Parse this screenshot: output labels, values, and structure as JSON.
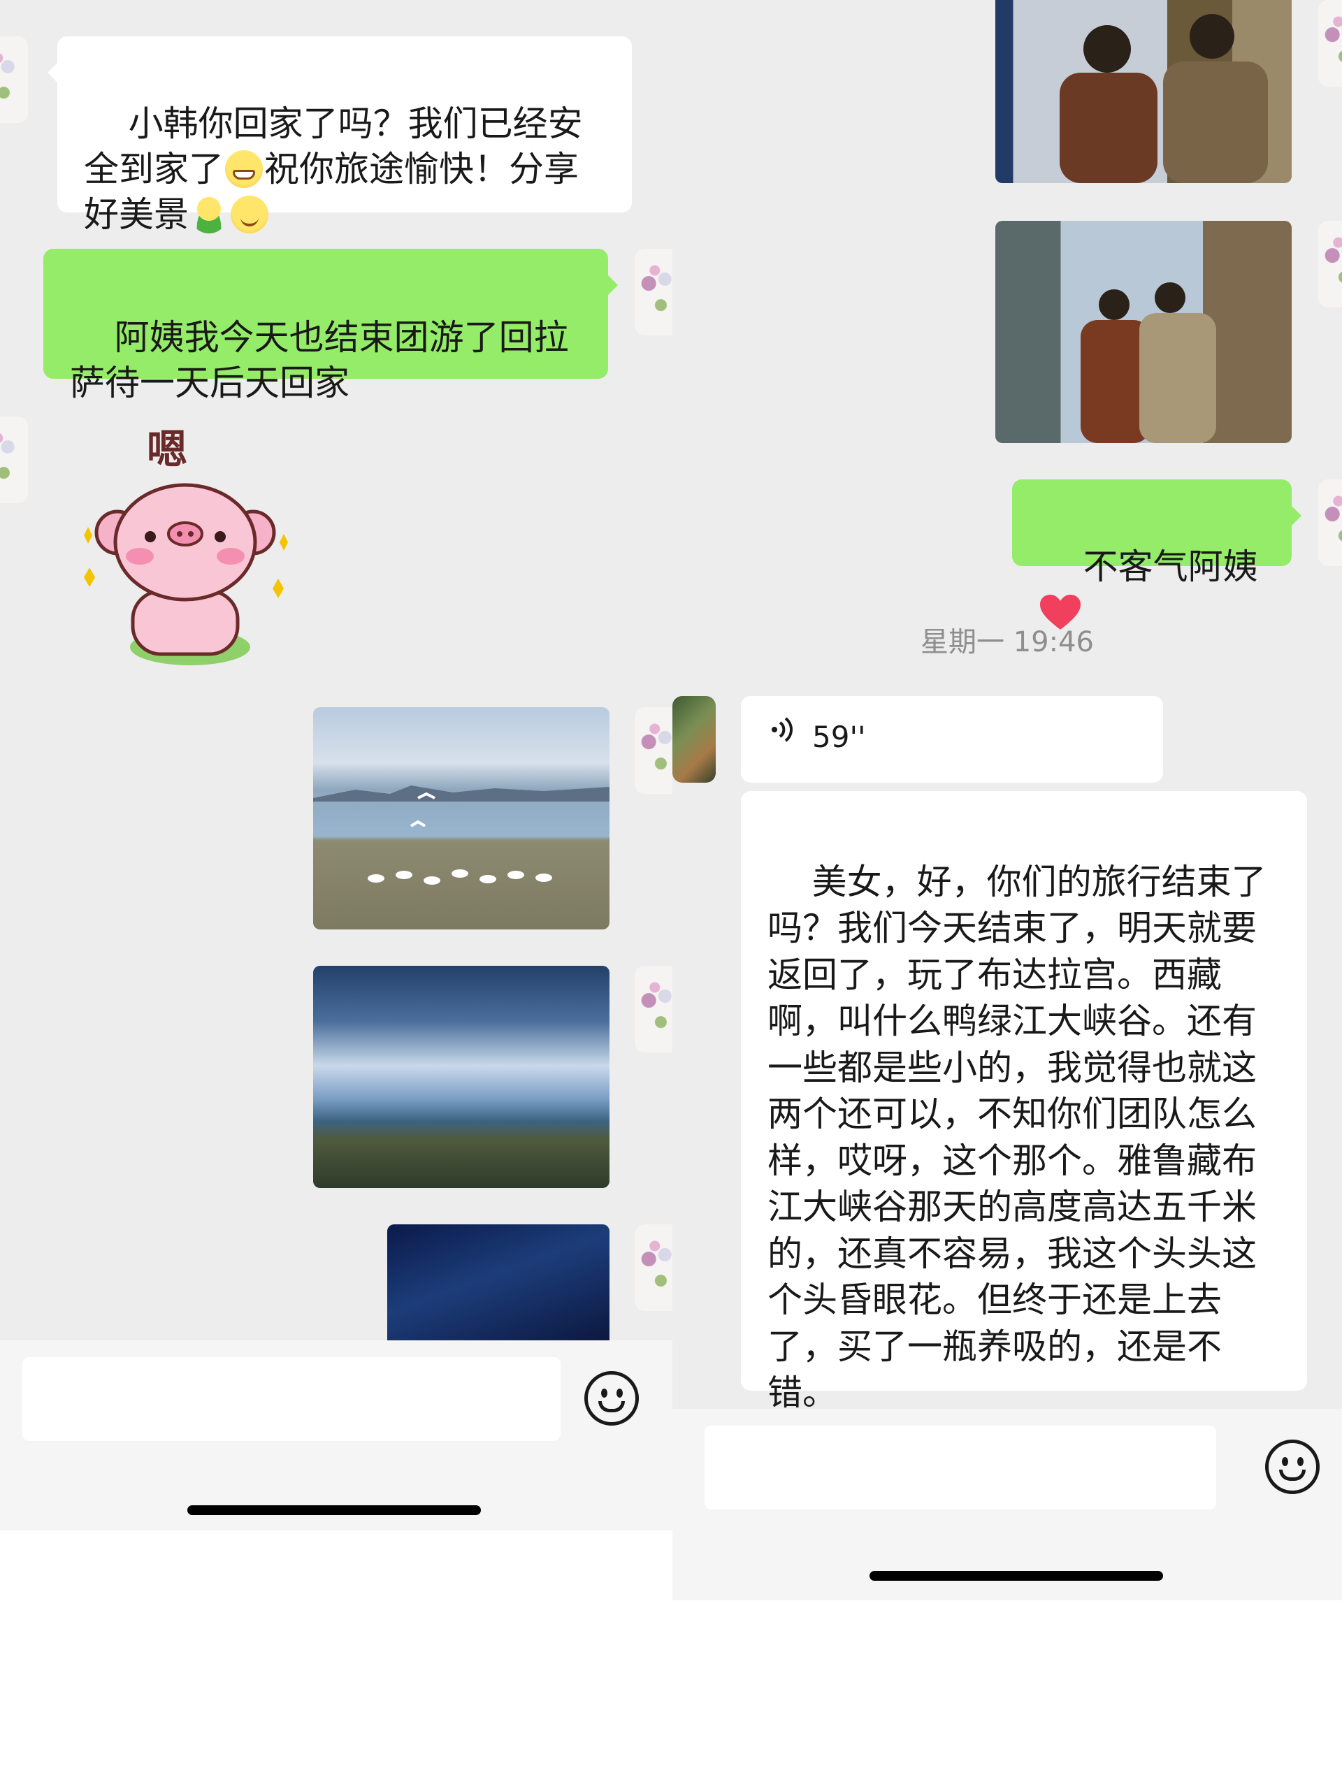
{
  "left_panel": {
    "messages": [
      {
        "from": "other",
        "text_part1": "小韩你回家了吗？我们已经安全到家了",
        "emoji1": "grin",
        "text_part2": "祝你旅途愉快！分享好美景",
        "emoji2": "hug",
        "emoji3": "smile"
      },
      {
        "from": "me",
        "text": "阿姨我今天也结束团游了回拉萨待一天后天回家"
      },
      {
        "from": "other",
        "sticker": "pig-sticker",
        "sticker_text": "嗯"
      },
      {
        "from": "me",
        "image": "lake-birds-photo"
      },
      {
        "from": "me",
        "image": "lake-sky-photo"
      },
      {
        "from": "me",
        "image": "night-sky-photo"
      }
    ]
  },
  "right_panel": {
    "messages": [
      {
        "from": "me",
        "image": "train-window-photo-1"
      },
      {
        "from": "me",
        "image": "train-window-photo-2"
      },
      {
        "from": "me",
        "text": "不客气阿姨",
        "emoji": "heart"
      }
    ],
    "timestamp": "星期一 19:46",
    "voice": {
      "duration": "59''"
    },
    "long_text": "美女，好，你们的旅行结束了吗？我们今天结束了，明天就要返回了，玩了布达拉宫。西藏啊，叫什么鸭绿江大峡谷。还有一些都是些小的，我觉得也就这两个还可以，不知你们团队怎么样，哎呀，这个那个。雅鲁藏布江大峡谷那天的高度高达五千米的，还真不容易，我这个头头这个头昏眼花。但终于还是上去了，买了一瓶养吸的，还是不错。"
  },
  "colors": {
    "green_bubble": "#95ec69",
    "chat_bg": "#ededed",
    "white_bubble": "#ffffff"
  }
}
